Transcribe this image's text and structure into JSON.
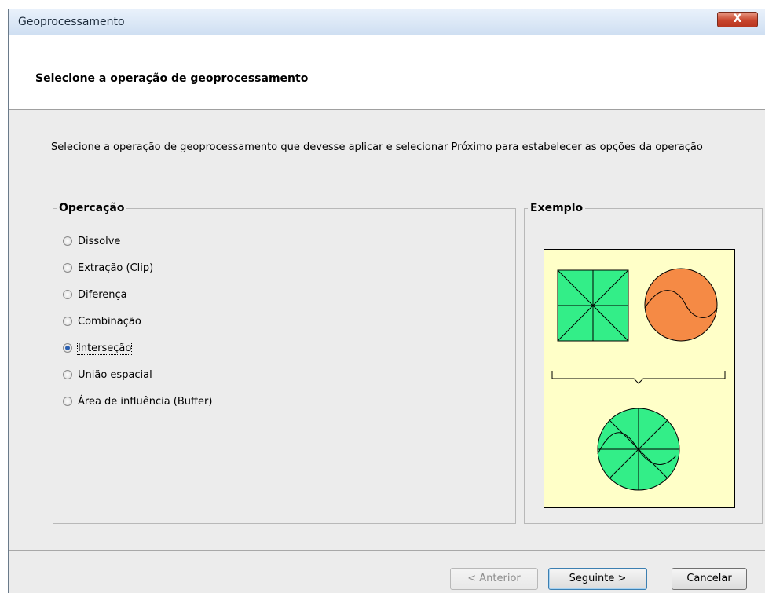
{
  "window": {
    "title": "Geoprocessamento",
    "close_label": "X"
  },
  "header": {
    "title": "Selecione a operação de geoprocessamento"
  },
  "description": "Selecione a operação de geoprocessamento que devesse aplicar e selecionar Próximo para estabelecer as opções da operação",
  "operation_group": {
    "legend": "Opercação",
    "options": [
      {
        "label": "Dissolve",
        "checked": false
      },
      {
        "label": "Extração (Clip)",
        "checked": false
      },
      {
        "label": "Diferença",
        "checked": false
      },
      {
        "label": "Combinação",
        "checked": false
      },
      {
        "label": "Interseção",
        "checked": true
      },
      {
        "label": "União espacial",
        "checked": false
      },
      {
        "label": "Área de influência (Buffer)",
        "checked": false
      }
    ]
  },
  "example_group": {
    "legend": "Exemplo",
    "colors": {
      "background": "#ffffc8",
      "square_fill": "#33ee88",
      "circle_fill": "#f58a45",
      "result_fill": "#33ee88"
    }
  },
  "buttons": {
    "previous": {
      "label": "< Anterior",
      "enabled": false
    },
    "next": {
      "label": "Seguinte >",
      "enabled": true
    },
    "cancel": {
      "label": "Cancelar",
      "enabled": true
    }
  }
}
